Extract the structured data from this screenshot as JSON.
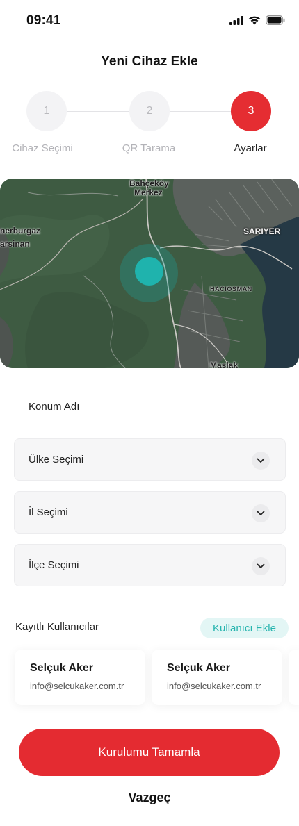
{
  "status_bar": {
    "time": "09:41"
  },
  "page": {
    "title": "Yeni Cihaz Ekle"
  },
  "stepper": {
    "steps": [
      {
        "number": "1",
        "label": "Cihaz Seçimi",
        "active": false
      },
      {
        "number": "2",
        "label": "QR Tarama",
        "active": false
      },
      {
        "number": "3",
        "label": "Ayarlar",
        "active": true
      }
    ]
  },
  "map": {
    "labels": [
      "Bahçeköy",
      "Merkez",
      "nerburgaz",
      "arsinan",
      "SARIYER",
      "HACIOSMAN",
      "Maslak"
    ]
  },
  "form": {
    "location_name_label": "Konum Adı",
    "country_select": "Ülke Seçimi",
    "province_select": "İl Seçimi",
    "district_select": "İlçe Seçimi"
  },
  "users": {
    "title": "Kayıtlı Kullanıcılar",
    "add_label": "Kullanıcı Ekle",
    "list": [
      {
        "name": "Selçuk Aker",
        "email": "info@selcukaker.com.tr"
      },
      {
        "name": "Selçuk Aker",
        "email": "info@selcukaker.com.tr"
      }
    ]
  },
  "actions": {
    "complete_label": "Kurulumu Tamamla",
    "cancel_label": "Vazgeç"
  },
  "colors": {
    "accent_red": "#e52d32",
    "accent_teal": "#1fb3ad",
    "map_green": "#3d5a41"
  },
  "icons": [
    "signal-icon",
    "wifi-icon",
    "battery-icon",
    "chevron-down-icon",
    "location-pin-icon"
  ]
}
